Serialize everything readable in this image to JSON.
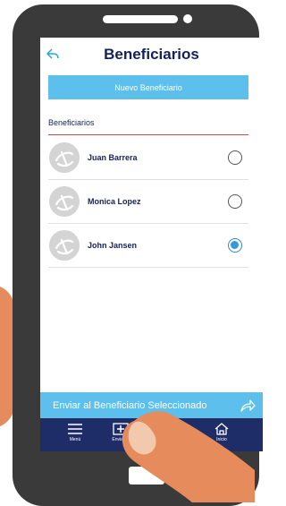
{
  "header": {
    "title": "Beneficiarios"
  },
  "actions": {
    "new_beneficiary": "Nuevo Beneficiario"
  },
  "section": {
    "label": "Beneficiarios"
  },
  "beneficiaries": [
    {
      "name": "Juan Barrera",
      "selected": false
    },
    {
      "name": "Monica Lopez",
      "selected": false
    },
    {
      "name": "John Jansen",
      "selected": true
    }
  ],
  "send": {
    "label": "Enviar al Beneficiario Seleccionado"
  },
  "tabbar": {
    "items": [
      {
        "label": "Menú",
        "icon": "hamburger-menu-icon"
      },
      {
        "label": "Enviar D",
        "icon": "plus-box-icon"
      },
      {
        "label": "",
        "icon": "car-icon"
      },
      {
        "label": "Inicio",
        "icon": "home-icon"
      }
    ]
  },
  "colors": {
    "accent": "#5cbfec",
    "title": "#13225a",
    "tabbar": "#1e2c68",
    "divider": "#c44b4b",
    "device": "#3a3a3a",
    "skin": "#e68b5b"
  }
}
